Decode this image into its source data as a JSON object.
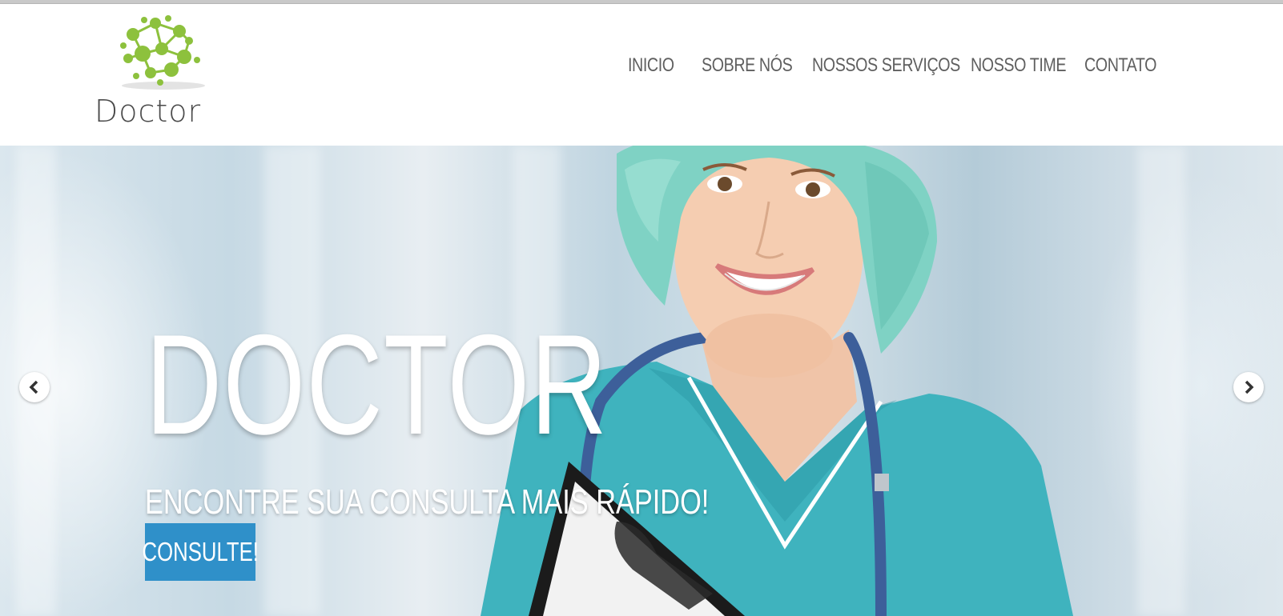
{
  "brand": {
    "name": "Doctor",
    "logo_icon": "molecule-network-icon",
    "logo_color": "#8dc13d"
  },
  "nav": {
    "items": [
      {
        "label": "INICIO"
      },
      {
        "label": "SOBRE NÓS"
      },
      {
        "label": "NOSSOS SERVIÇOS"
      },
      {
        "label": "NOSSO TIME"
      },
      {
        "label": "CONTATO"
      }
    ]
  },
  "hero": {
    "title": "DOCTOR",
    "subtitle": "ENCONTRE SUA CONSULTA MAIS RÁPIDO!",
    "cta_label": "CONSULTE!",
    "cta_color": "#2f90c9",
    "prev_icon": "chevron-left-icon",
    "next_icon": "chevron-right-icon"
  }
}
